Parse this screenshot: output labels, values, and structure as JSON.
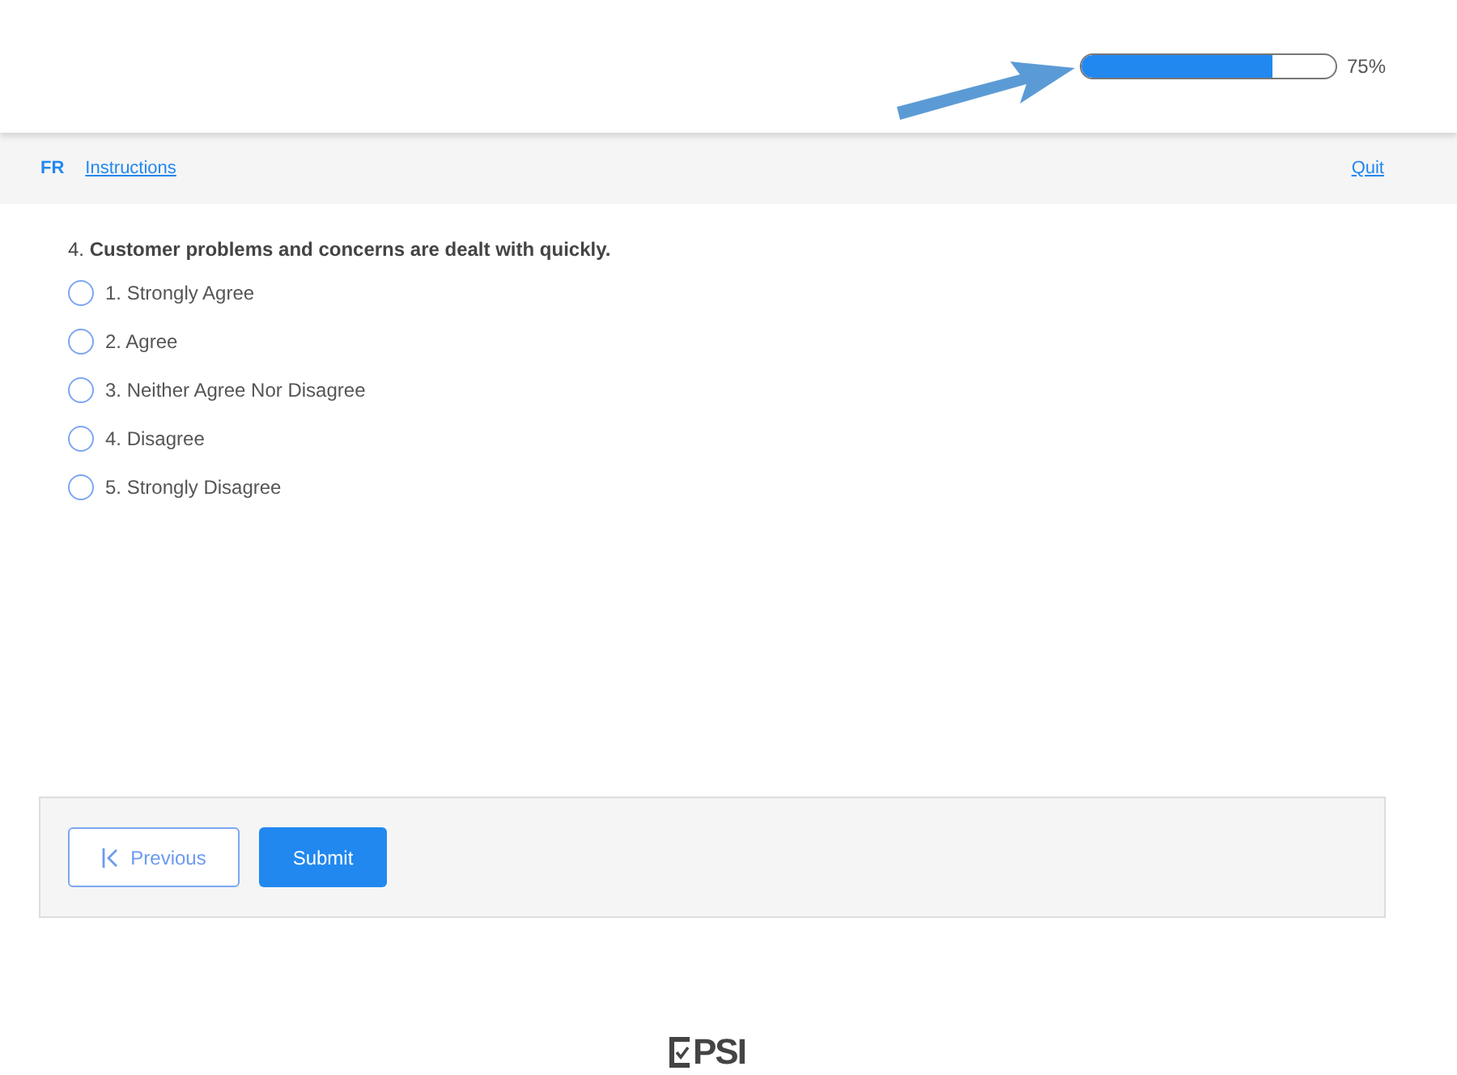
{
  "progress": {
    "level": 0.75,
    "reading": "75%"
  },
  "nav": {
    "language": "FR",
    "instructions": "Instructions",
    "quit": "Quit"
  },
  "question": {
    "text": "4. **Customer problems and concerns are dealt with quickly.**",
    "options": [
      {
        "label": "1. Strongly Agree",
        "selected": false
      },
      {
        "label": "2. Agree",
        "selected": false
      },
      {
        "label": "3. Neither Agree Nor Disagree",
        "selected": false
      },
      {
        "label": "4. Disagree",
        "selected": false
      },
      {
        "label": "5. Strongly Disagree",
        "selected": false
      }
    ]
  },
  "buttons": {
    "previous": "Previous",
    "submit": "Submit"
  },
  "logo": {
    "text": "PSI"
  }
}
